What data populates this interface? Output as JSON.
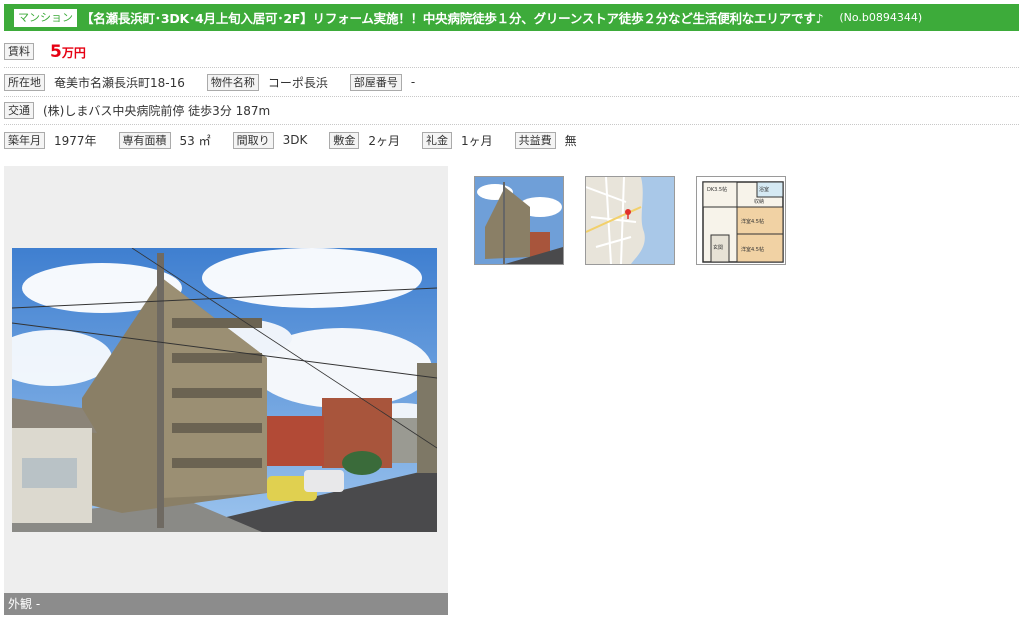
{
  "listing": {
    "type_badge": "マンション",
    "title": "【名瀬長浜町･3DK･4月上旬入居可･2F】リフォーム実施！！中央病院徒歩１分、グリーンストア徒歩２分など生活便利なエリアです♪",
    "property_no": "(No.b0894344)"
  },
  "rent": {
    "label": "賃料",
    "amount": "5",
    "unit": "万円"
  },
  "location_row": {
    "address_label": "所在地",
    "address": "奄美市名瀬長浜町18-16",
    "name_label": "物件名称",
    "name": "コーポ長浜",
    "room_label": "部屋番号",
    "room": "-"
  },
  "transport": {
    "label": "交通",
    "value": "(株)しまバス中央病院前停  徒歩3分 187m"
  },
  "details": {
    "built_label": "築年月",
    "built": "1977年",
    "area_label": "専有面積",
    "area": "53 ㎡",
    "layout_label": "間取り",
    "layout": "3DK",
    "deposit_label": "敷金",
    "deposit": "2ヶ月",
    "key_money_label": "礼金",
    "key_money": "1ヶ月",
    "common_fee_label": "共益費",
    "common_fee": "無"
  },
  "photo": {
    "caption": "外観 -"
  },
  "thumbnails": [
    "exterior-thumbnail",
    "map-thumbnail",
    "floorplan-thumbnail"
  ],
  "floorplan": {
    "dk_label": "DK3.5帖",
    "storage_label": "収納",
    "bath_label": "浴室",
    "entrance_label": "玄関",
    "room1_label": "洋室4.5帖",
    "room2_label": "洋室4.5帖"
  },
  "colors": {
    "title_bar": "#3dab3a",
    "rent": "#e60012",
    "caption_bar": "#8c8c8c"
  }
}
